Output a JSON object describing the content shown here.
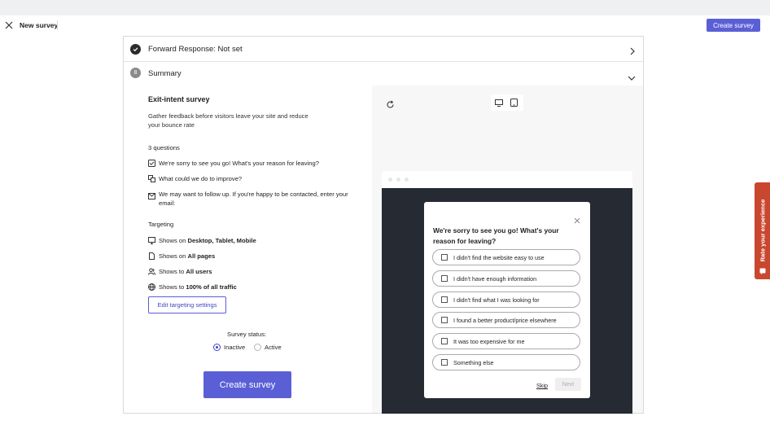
{
  "header": {
    "title": "New survey",
    "create_button": "Create survey"
  },
  "forward_row": {
    "title": "Forward Response: Not set"
  },
  "summary_row": {
    "step": "8",
    "title": "Summary"
  },
  "summary": {
    "heading": "Exit-intent survey",
    "description": "Gather feedback before visitors leave your site and reduce your bounce rate",
    "questions_count": "3 questions",
    "questions": [
      {
        "icon": "checkbox-icon",
        "text": "We're sorry to see you go! What's your reason for leaving?"
      },
      {
        "icon": "chat-bubbles-icon",
        "text": "What could we do to improve?"
      },
      {
        "icon": "email-icon",
        "text": "We may want to follow up. If you're happy to be contacted, enter your email:"
      }
    ],
    "targeting_label": "Targeting",
    "targeting": [
      {
        "icon": "monitor-icon",
        "prefix": "Shows on ",
        "value": "Desktop, Tablet, Mobile"
      },
      {
        "icon": "page-icon",
        "prefix": "Shows on ",
        "value": "All pages"
      },
      {
        "icon": "users-icon",
        "prefix": "Shows to ",
        "value": "All users"
      },
      {
        "icon": "globe-icon",
        "prefix": "Shows to ",
        "value": "100% of all traffic"
      }
    ],
    "edit_button": "Edit targeting settings",
    "status_label": "Survey status:",
    "status_options": [
      "Inactive",
      "Active"
    ],
    "status_selected": "Inactive",
    "create_button": "Create survey"
  },
  "preview": {
    "modal": {
      "question": "We're sorry to see you go! What's your reason for leaving?",
      "options": [
        "I didn't find the website easy to use",
        "I didn't have enough information",
        "I didn't find what I was looking for",
        "I found a better product/price elsewhere",
        "It was too expensive for me",
        "Something else"
      ],
      "skip": "Skip",
      "next": "Next"
    }
  },
  "feedback_tab": {
    "label": "Rate your experience"
  },
  "colors": {
    "accent": "#5a5fd6",
    "feedback_tab": "#c9472e",
    "preview_dark": "#262a33"
  }
}
